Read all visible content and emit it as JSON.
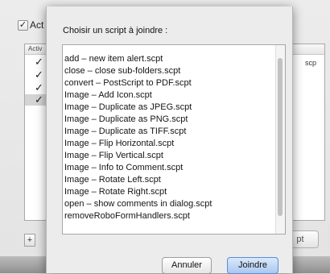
{
  "background": {
    "check_label": "Act",
    "table_header": "Activ",
    "right_text": "scp",
    "plus_label": "+",
    "right_button_label": "pt"
  },
  "dialog": {
    "title": "Choisir un script à joindre :",
    "scripts": [
      "add – new item alert.scpt",
      "close – close sub-folders.scpt",
      "convert – PostScript to PDF.scpt",
      "Image – Add Icon.scpt",
      "Image – Duplicate as JPEG.scpt",
      "Image – Duplicate as PNG.scpt",
      "Image – Duplicate as TIFF.scpt",
      "Image – Flip Horizontal.scpt",
      "Image – Flip Vertical.scpt",
      "Image – Info to Comment.scpt",
      "Image – Rotate Left.scpt",
      "Image – Rotate Right.scpt",
      "open – show comments in dialog.scpt",
      "removeRoboFormHandlers.scpt"
    ],
    "cancel_label": "Annuler",
    "join_label": "Joindre"
  }
}
